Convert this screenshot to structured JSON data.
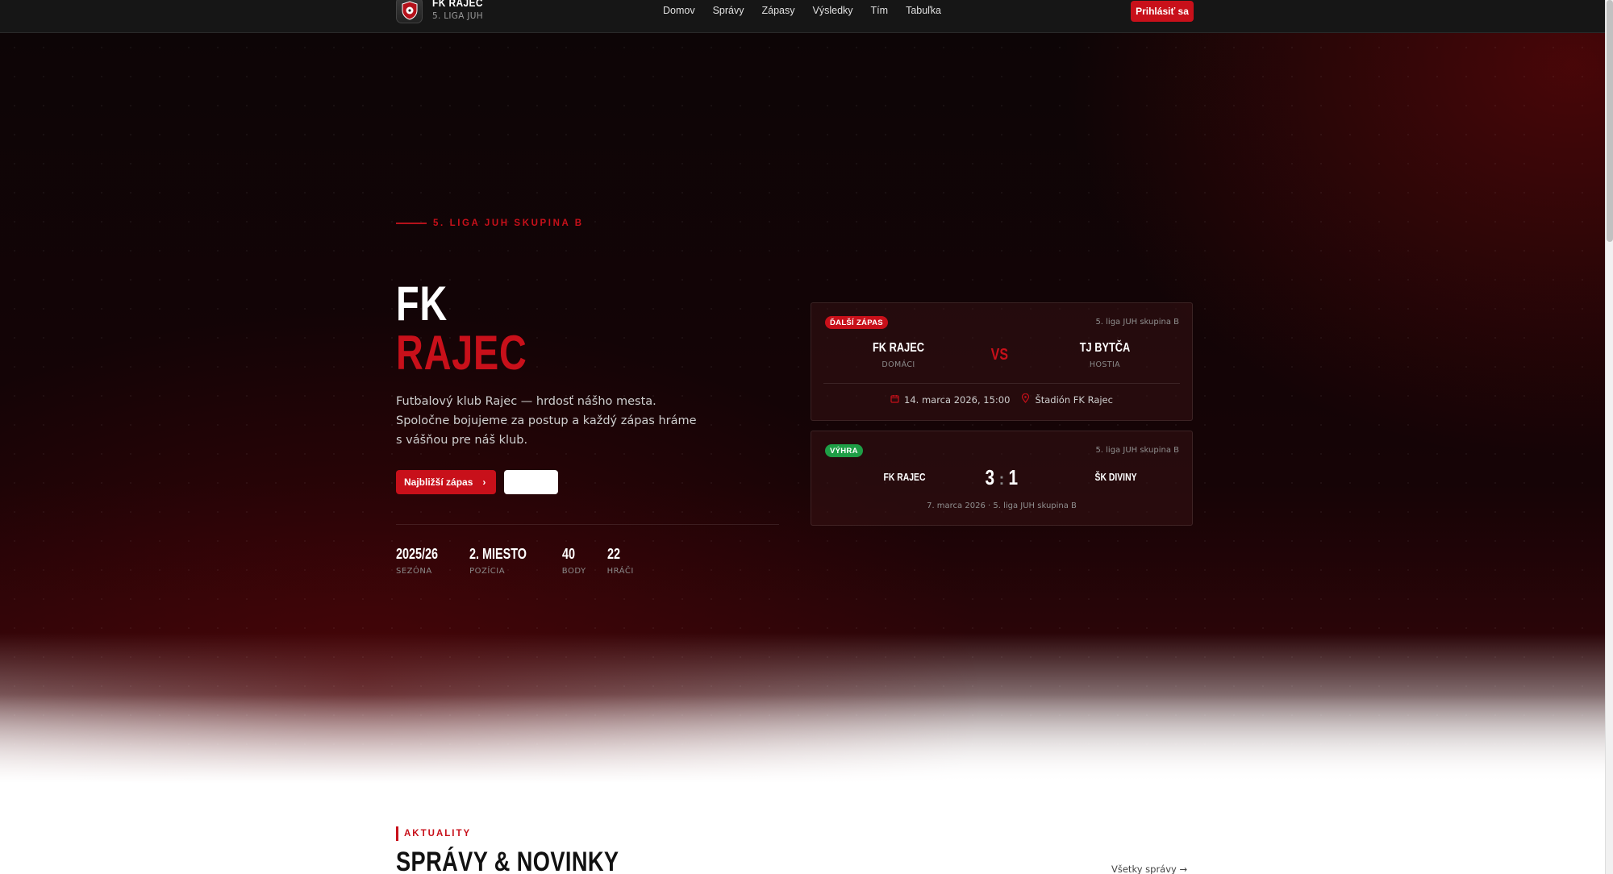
{
  "nav": {
    "brand_name": "FK RAJEC",
    "brand_sub": "5. LIGA JUH",
    "menu": [
      "Domov",
      "Správy",
      "Zápasy",
      "Výsledky",
      "Tím",
      "Tabuľka"
    ],
    "login_label": "Prihlásiť sa"
  },
  "hero": {
    "eyebrow": "5. LIGA JUH SKUPINA B",
    "title_line1": "FK",
    "title_line2": "RAJEC",
    "lead": "Futbalový klub Rajec — hrdosť nášho mesta. Spoločne bojujeme za postup a každý zápas hráme s vášňou pre náš klub.",
    "primary_button": "Najbližší zápas",
    "secondary_button": "",
    "stats": [
      {
        "value": "2025/26",
        "label": "SEZÓNA"
      },
      {
        "value": "2. MIESTO",
        "label": "POZÍCIA"
      },
      {
        "value": "40",
        "label": "BODY"
      },
      {
        "value": "22",
        "label": "HRÁČI"
      }
    ]
  },
  "next_match": {
    "badge": "ĎALŠÍ ZÁPAS",
    "league": "5. liga JUH skupina B",
    "home_team": "FK RAJEC",
    "home_role": "DOMÁCI",
    "vs": "VS",
    "away_team": "TJ BYTČA",
    "away_role": "HOSTIA",
    "date": "14. marca 2026, 15:00",
    "venue": "Štadión FK Rajec"
  },
  "last_result": {
    "badge": "VÝHRA",
    "league": "5. liga JUH skupina B",
    "home_team": "FK RAJEC",
    "home_score": "3",
    "away_score": "1",
    "away_team": "ŠK DIVINY",
    "meta": "7. marca 2026 · 5. liga JUH skupina B"
  },
  "news": {
    "eyebrow": "AKTUALITY",
    "title": "SPRÁVY & NOVINKY",
    "all_link": "Všetky správy →"
  },
  "colors": {
    "accent": "#c8101a",
    "win": "#1e9e46",
    "nav_bg": "#161616"
  }
}
